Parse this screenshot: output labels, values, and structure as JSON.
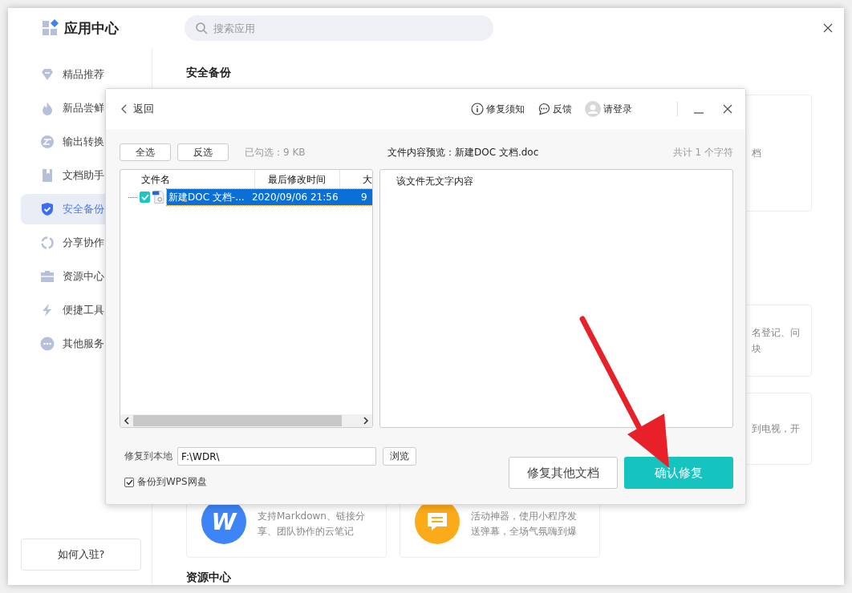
{
  "app": {
    "title": "应用中心",
    "search": {
      "placeholder": "搜索应用"
    }
  },
  "sidebar": {
    "items": [
      {
        "kind": "gem",
        "label": "精品推荐",
        "selected": false
      },
      {
        "kind": "flame",
        "label": "新品尝鲜",
        "selected": false
      },
      {
        "kind": "convert",
        "label": "输出转换",
        "selected": false
      },
      {
        "kind": "doc",
        "label": "文档助手",
        "selected": false
      },
      {
        "kind": "shield",
        "label": "安全备份",
        "selected": true
      },
      {
        "kind": "share",
        "label": "分享协作",
        "selected": false
      },
      {
        "kind": "case",
        "label": "资源中心",
        "selected": false
      },
      {
        "kind": "bolt",
        "label": "便捷工具",
        "selected": false
      },
      {
        "kind": "more",
        "label": "其他服务",
        "selected": false
      }
    ],
    "footer_button": "如何入驻?"
  },
  "main": {
    "heading": "安全备份",
    "side_cards": [
      {
        "lines": [
          "档"
        ]
      },
      {
        "lines": [
          "名登记、问",
          "块"
        ]
      },
      {
        "lines": [
          "到电视，开"
        ]
      }
    ],
    "bottom_cards": [
      {
        "kind": "note",
        "logo_text": "W",
        "desc": "支持Markdown、链接分享、团队协作的云笔记"
      },
      {
        "kind": "chat",
        "desc": "活动神器，使用小程序发送弹幕，全场气氛嗨到爆"
      }
    ],
    "next_heading": "资源中心"
  },
  "dialog": {
    "back": "返回",
    "header_links": [
      {
        "kind": "info",
        "label": "修复须知"
      },
      {
        "kind": "feedback",
        "label": "反馈"
      },
      {
        "kind": "user",
        "label": "请登录"
      }
    ],
    "select_all": "全选",
    "invert": "反选",
    "selected_size": "已勾选：9 KB",
    "preview_title": "文件内容预览：新建DOC 文档.doc",
    "char_count": "共计 1 个字符",
    "columns": [
      "文件名",
      "最后修改时间",
      "大"
    ],
    "rows": [
      {
        "checked": true,
        "selected": true,
        "name": "新建DOC 文档-...",
        "modified": "2020/09/06 21:56",
        "size": "9"
      }
    ],
    "preview_text": "该文件无文字内容",
    "restore_label": "修复到本地",
    "path": "F:\\WDR\\",
    "browse": "浏览",
    "backup": {
      "label": "备份到WPS网盘",
      "checked": true
    },
    "other": "修复其他文档",
    "confirm": "确认修复"
  }
}
